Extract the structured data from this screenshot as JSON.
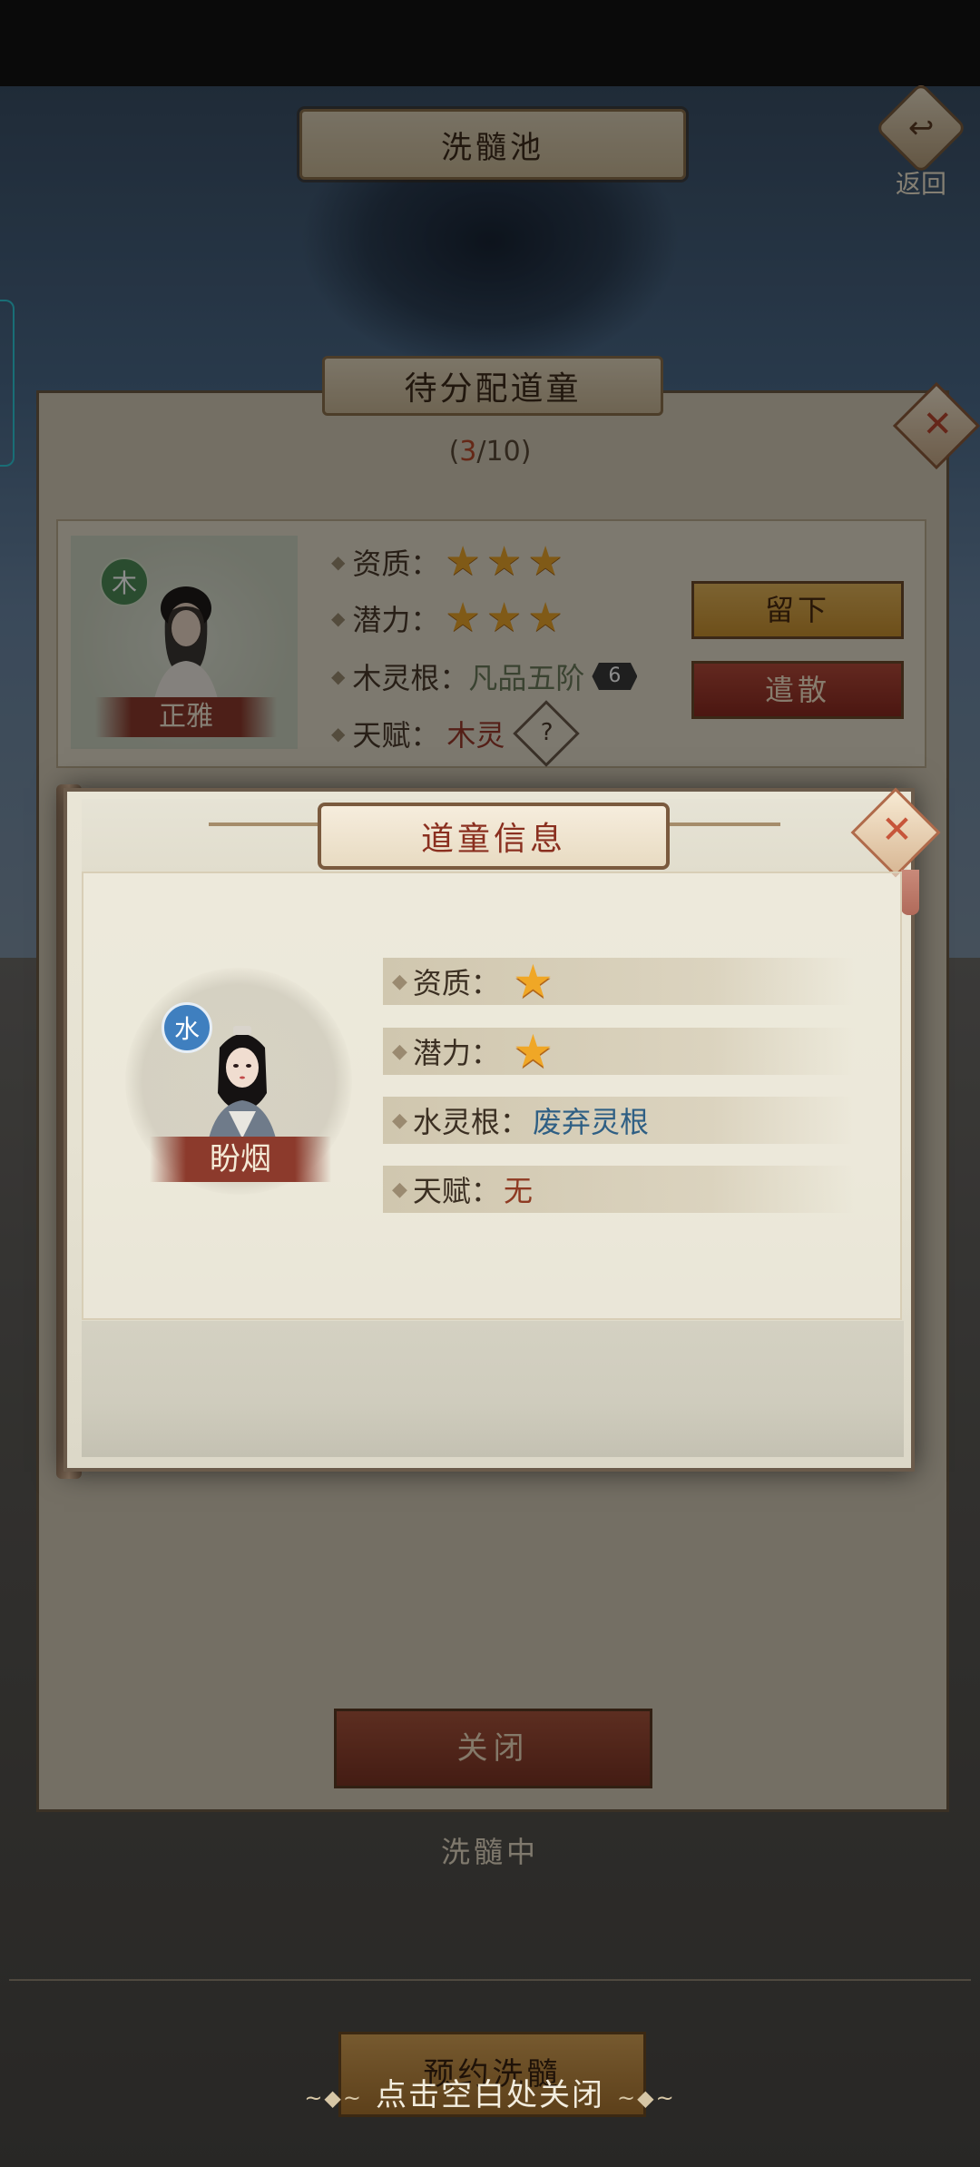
{
  "header": {
    "title": "洗髓池",
    "back_label": "返回"
  },
  "panel": {
    "title": "待分配道童",
    "counter_current": "3",
    "counter_total": "10",
    "card": {
      "element": "木",
      "name": "正雅",
      "aptitude_label": "资质：",
      "aptitude_stars": 3,
      "potential_label": "潜力：",
      "potential_stars": 3,
      "root_label": "木灵根：",
      "root_value": "凡品五阶",
      "root_level": "6",
      "talent_label": "天赋：",
      "talent_value": "木灵",
      "talent_icon": "?",
      "keep_label": "留下",
      "dismiss_label": "遣散"
    },
    "close_label": "关闭"
  },
  "modal": {
    "title": "道童信息",
    "element": "水",
    "name": "盼烟",
    "aptitude_label": "资质：",
    "aptitude_stars": 1,
    "potential_label": "潜力：",
    "potential_stars": 1,
    "root_label": "水灵根：",
    "root_value": "废弃灵根",
    "talent_label": "天赋：",
    "talent_value": "无"
  },
  "background": {
    "washing_label": "洗髓中",
    "reserve_label": "预约洗髓"
  },
  "hint": "点击空白处关闭",
  "icons": {
    "star": "star-icon",
    "close": "close-icon",
    "back": "back-arrow-icon",
    "question": "question-icon"
  },
  "colors": {
    "accent_red": "#8a2f1f",
    "star_gold": "#f0a726",
    "water_blue": "#3f7fbf",
    "wood_green": "#4e8a57"
  }
}
